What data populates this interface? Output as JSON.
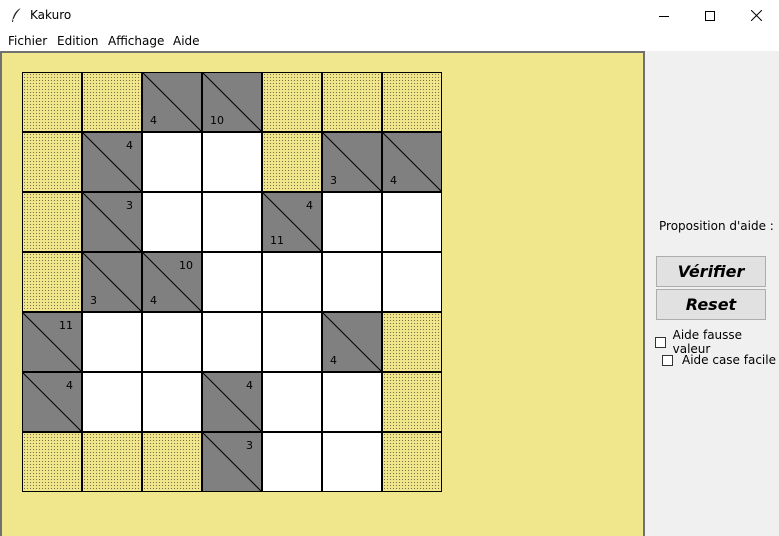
{
  "window": {
    "title": "Kakuro",
    "icon": "feather-icon"
  },
  "menu": [
    "Fichier",
    "Edition",
    "Affichage",
    "Aide"
  ],
  "board": {
    "rows": [
      [
        {
          "t": "b"
        },
        {
          "t": "b"
        },
        {
          "t": "c",
          "d": "4"
        },
        {
          "t": "c",
          "d": "10"
        },
        {
          "t": "b"
        },
        {
          "t": "b"
        },
        {
          "t": "b"
        }
      ],
      [
        {
          "t": "b"
        },
        {
          "t": "c",
          "r": "4"
        },
        {
          "t": "w"
        },
        {
          "t": "w"
        },
        {
          "t": "b"
        },
        {
          "t": "c",
          "d": "3"
        },
        {
          "t": "c",
          "d": "4"
        }
      ],
      [
        {
          "t": "b"
        },
        {
          "t": "c",
          "r": "3"
        },
        {
          "t": "w"
        },
        {
          "t": "w"
        },
        {
          "t": "c",
          "r": "4",
          "d": "11"
        },
        {
          "t": "w"
        },
        {
          "t": "w"
        }
      ],
      [
        {
          "t": "b"
        },
        {
          "t": "c",
          "d": "3"
        },
        {
          "t": "c",
          "r": "10",
          "d": "4"
        },
        {
          "t": "w"
        },
        {
          "t": "w"
        },
        {
          "t": "w"
        },
        {
          "t": "w"
        }
      ],
      [
        {
          "t": "c",
          "r": "11"
        },
        {
          "t": "w"
        },
        {
          "t": "w"
        },
        {
          "t": "w"
        },
        {
          "t": "w"
        },
        {
          "t": "c",
          "d": "4"
        },
        {
          "t": "b"
        }
      ],
      [
        {
          "t": "c",
          "r": "4"
        },
        {
          "t": "w"
        },
        {
          "t": "w"
        },
        {
          "t": "c",
          "r": "4"
        },
        {
          "t": "w"
        },
        {
          "t": "w"
        },
        {
          "t": "b"
        }
      ],
      [
        {
          "t": "b"
        },
        {
          "t": "b"
        },
        {
          "t": "b"
        },
        {
          "t": "c",
          "r": "3"
        },
        {
          "t": "w"
        },
        {
          "t": "w"
        },
        {
          "t": "b"
        }
      ]
    ]
  },
  "side_panel": {
    "aide_label": "Proposition d'aide :",
    "verify_button": "Vérifier",
    "reset_button": "Reset",
    "check_wrong": {
      "label": "Aide fausse valeur",
      "checked": false
    },
    "check_easy": {
      "label": "Aide case facile",
      "checked": false
    }
  },
  "colors": {
    "canvas": "#f0e68c",
    "clue": "#808080",
    "white": "#ffffff"
  }
}
